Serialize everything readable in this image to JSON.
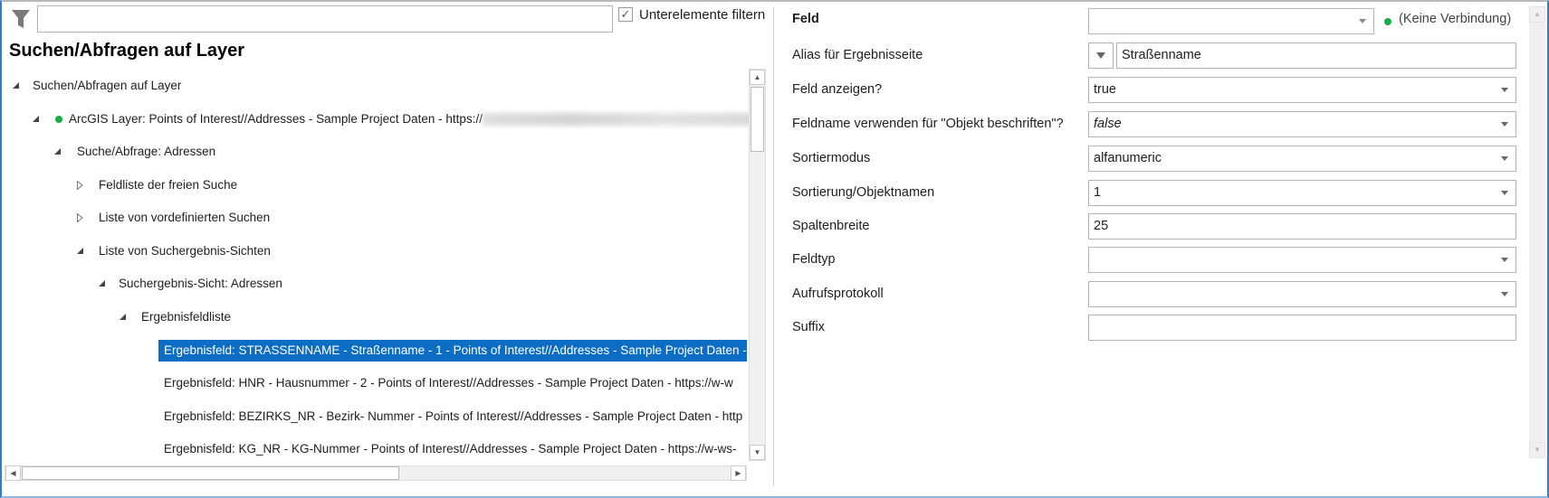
{
  "filter": {
    "value": "",
    "checkbox_label": "Unterelemente filtern",
    "checkbox_checked": true
  },
  "title": "Suchen/Abfragen auf Layer",
  "tree": [
    {
      "label": "Suchen/Abfragen auf Layer",
      "expanded": true
    },
    {
      "label": "ArcGIS Layer: Points of Interest//Addresses - Sample Project Daten - https://",
      "expanded": true,
      "status": "green"
    },
    {
      "label": "Suche/Abfrage: Adressen",
      "expanded": true
    },
    {
      "label": "Feldliste der freien Suche",
      "expanded": false
    },
    {
      "label": "Liste von vordefinierten Suchen",
      "expanded": false
    },
    {
      "label": "Liste von Suchergebnis-Sichten",
      "expanded": true
    },
    {
      "label": "Suchergebnis-Sicht: Adressen",
      "expanded": true
    },
    {
      "label": "Ergebnisfeldliste",
      "expanded": true
    },
    {
      "label": "Ergebnisfeld: STRASSENNAME - Straßenname - 1 - Points of Interest//Addresses - Sample Project Daten -",
      "selected": true
    },
    {
      "label": "Ergebnisfeld: HNR - Hausnummer - 2 - Points of Interest//Addresses - Sample Project Daten - https://w-w"
    },
    {
      "label": "Ergebnisfeld: BEZIRKS_NR - Bezirk- Nummer - Points of Interest//Addresses - Sample Project Daten - http"
    },
    {
      "label": "Ergebnisfeld: KG_NR - KG-Nummer - Points of Interest//Addresses - Sample Project Daten - https://w-ws-"
    }
  ],
  "properties": [
    {
      "label": "Feld",
      "value": "",
      "type": "combo",
      "status": "(Keine Verbindung)"
    },
    {
      "label": "Alias für Ergebnisseite",
      "value": "Straßenname",
      "type": "text-dropdown"
    },
    {
      "label": "Feld anzeigen?",
      "value": "true",
      "type": "combo"
    },
    {
      "label": "Feldname verwenden für \"Objekt beschriften\"?",
      "value": "false",
      "type": "combo"
    },
    {
      "label": "Sortiermodus",
      "value": "alfanumeric",
      "type": "combo"
    },
    {
      "label": "Sortierung/Objektnamen",
      "value": "1",
      "type": "combo"
    },
    {
      "label": "Spaltenbreite",
      "value": "25",
      "type": "text"
    },
    {
      "label": "Feldtyp",
      "value": "",
      "type": "combo"
    },
    {
      "label": "Aufrufsprotokoll",
      "value": "",
      "type": "combo"
    },
    {
      "label": "Suffix",
      "value": "",
      "type": "text"
    }
  ],
  "colors": {
    "selection": "#0c6dc4",
    "status_ok": "#12b03c",
    "accent_border": "#2b7fd0"
  }
}
